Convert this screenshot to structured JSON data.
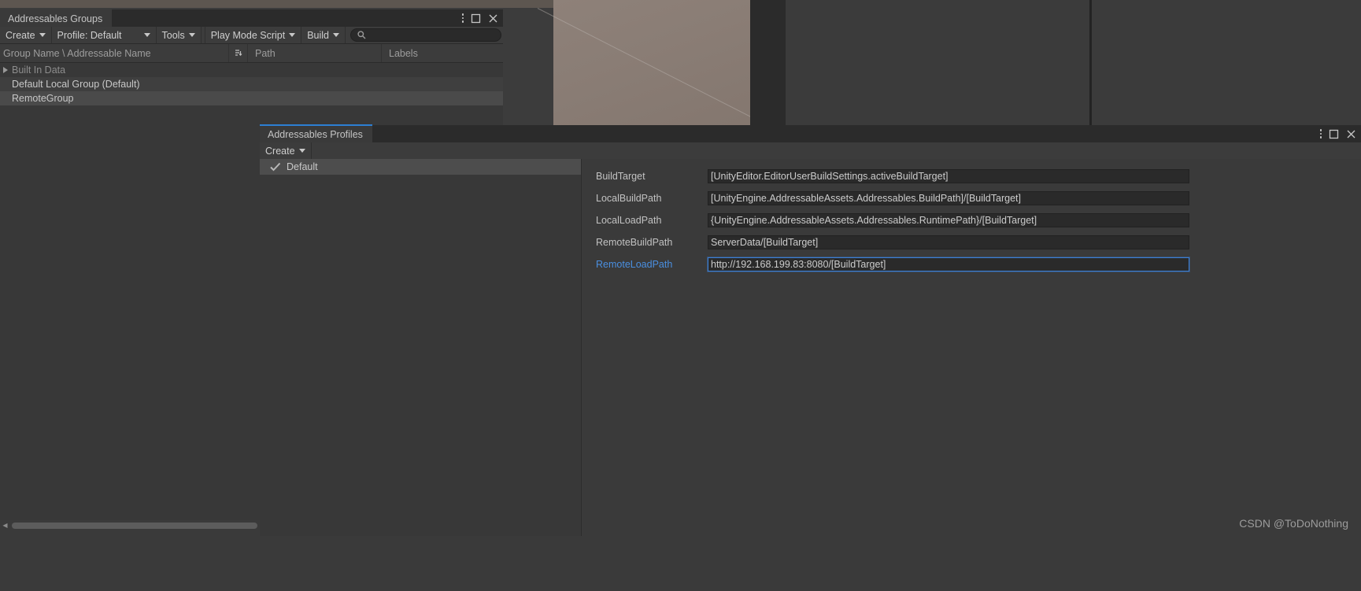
{
  "background": {
    "scene_label": "unity-scene-backdrop"
  },
  "groups_window": {
    "tab_label": "Addressables Groups",
    "controls": {
      "menu_icon": "kebab-menu-icon",
      "maximize_icon": "maximize-icon",
      "close_icon": "close-icon"
    },
    "toolbar": {
      "create_label": "Create",
      "profile_label": "Profile: Default",
      "tools_label": "Tools",
      "play_mode_script_label": "Play Mode Script",
      "build_label": "Build",
      "search_placeholder": "",
      "search_value": "",
      "search_icon": "search-icon"
    },
    "columns": [
      {
        "label": "Group Name \\ Addressable Name"
      },
      {
        "label": "Path"
      },
      {
        "label": "Labels"
      }
    ],
    "rows": [
      {
        "label": "Built In Data",
        "expandable": true,
        "dim": true,
        "selected": false
      },
      {
        "label": "Default Local Group (Default)",
        "expandable": false,
        "dim": false,
        "selected": false
      },
      {
        "label": "RemoteGroup",
        "expandable": false,
        "dim": false,
        "selected": true
      }
    ],
    "scrollbar": {
      "left_arrow": "◀",
      "right_arrow": "▶"
    }
  },
  "profiles_window": {
    "tab_label": "Addressables Profiles",
    "accent_color": "#2c7fd4",
    "controls": {
      "menu_icon": "kebab-menu-icon",
      "maximize_icon": "maximize-icon",
      "close_icon": "close-icon"
    },
    "toolbar": {
      "create_label": "Create"
    },
    "profile_list": [
      {
        "name": "Default",
        "active": true,
        "selected": true
      }
    ],
    "variables": [
      {
        "name": "BuildTarget",
        "value": "[UnityEditor.EditorUserBuildSettings.activeBuildTarget]",
        "focused": false
      },
      {
        "name": "LocalBuildPath",
        "value": "[UnityEngine.AddressableAssets.Addressables.BuildPath]/[BuildTarget]",
        "focused": false
      },
      {
        "name": "LocalLoadPath",
        "value": "{UnityEngine.AddressableAssets.Addressables.RuntimePath}/[BuildTarget]",
        "focused": false
      },
      {
        "name": "RemoteBuildPath",
        "value": "ServerData/[BuildTarget]",
        "focused": false
      },
      {
        "name": "RemoteLoadPath",
        "value": "http://192.168.199.83:8080/[BuildTarget]",
        "focused": true
      }
    ]
  },
  "watermark": {
    "text": "CSDN @ToDoNothing"
  }
}
